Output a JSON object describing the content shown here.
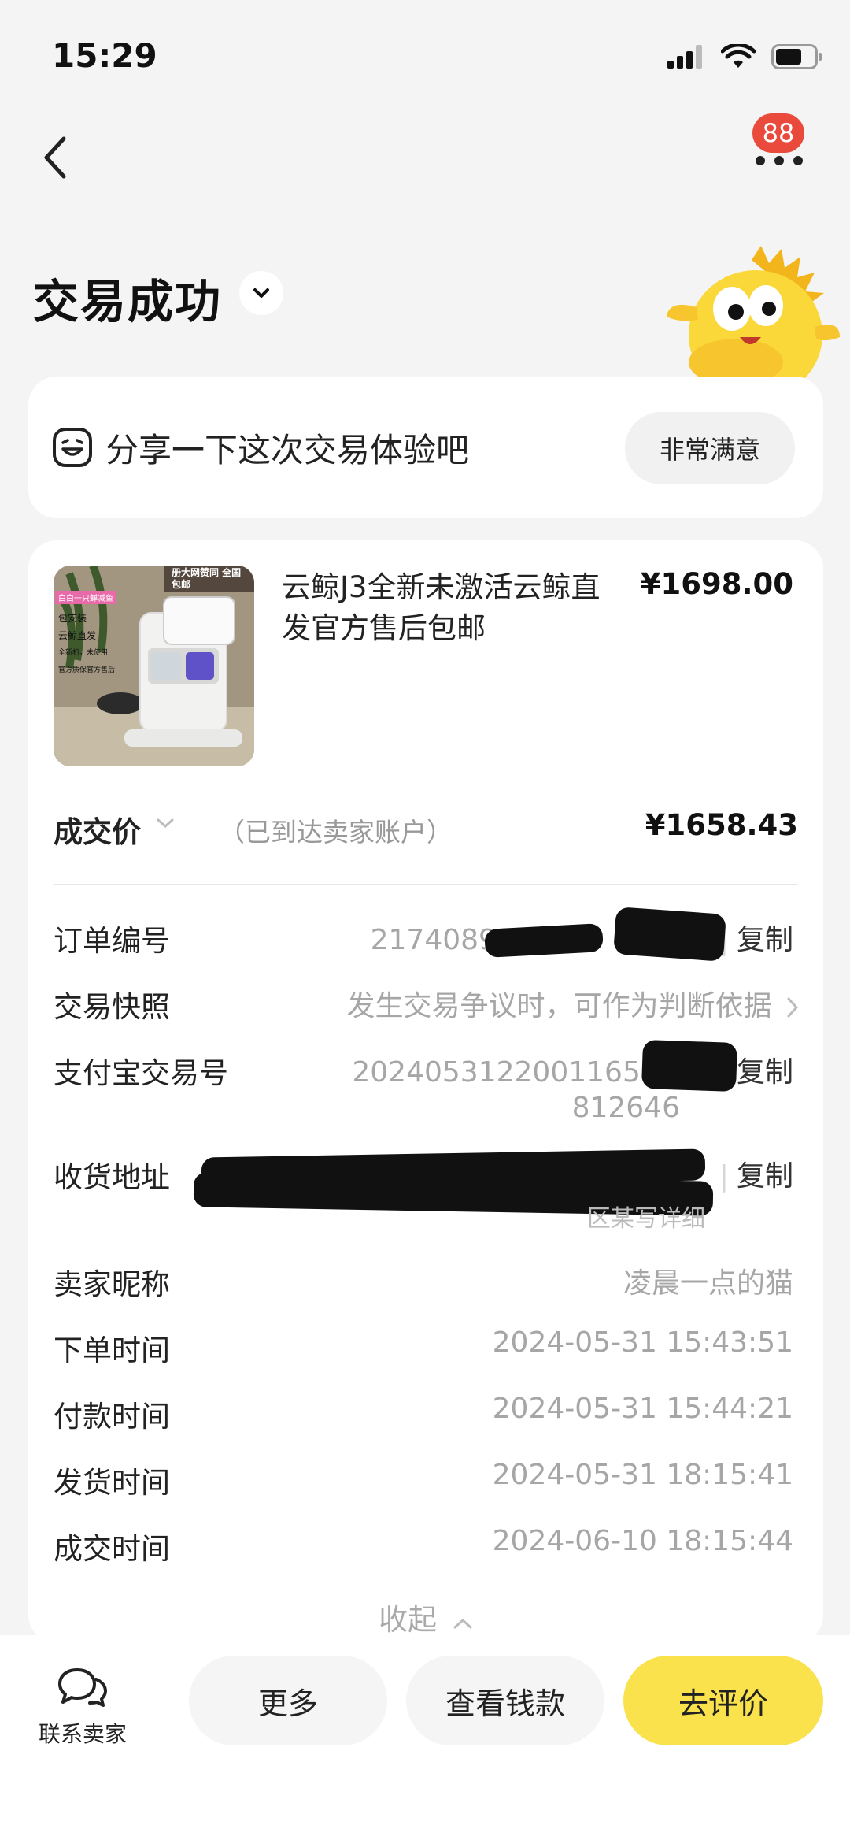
{
  "status": {
    "time": "15:29"
  },
  "nav": {
    "badge_count": "88"
  },
  "header": {
    "title": "交易成功"
  },
  "review_prompt": {
    "text": "分享一下这次交易体验吧",
    "button": "非常满意"
  },
  "product": {
    "title": "云鲸J3全新未激活云鲸直发官方售后包邮",
    "price": "¥1698.00",
    "image_banner": "册大网赞同 全国包邮",
    "image_tag": "白白一只蝉减鱼",
    "image_features": [
      "包安装",
      "云鲸直发",
      "全新机，未使用",
      "官方质保官方售后"
    ]
  },
  "deal": {
    "label": "成交价",
    "note": "（已到达卖家账户）",
    "price": "¥1658.43"
  },
  "info": {
    "order_no": {
      "label": "订单编号",
      "value": "21740897",
      "copy": "复制"
    },
    "snapshot": {
      "label": "交易快照",
      "value": "发生交易争议时，可作为判断依据"
    },
    "alipay_no": {
      "label": "支付宝交易号",
      "value": "2024053122001165",
      "value2": "812646",
      "copy": "复制"
    },
    "address": {
      "label": "收货地址",
      "value": "区某写详细",
      "copy": "复制"
    },
    "seller": {
      "label": "卖家昵称",
      "value": "凌晨一点的猫"
    },
    "order_time": {
      "label": "下单时间",
      "value": "2024-05-31 15:43:51"
    },
    "pay_time": {
      "label": "付款时间",
      "value": "2024-05-31 15:44:21"
    },
    "ship_time": {
      "label": "发货时间",
      "value": "2024-05-31 18:15:41"
    },
    "deal_time": {
      "label": "成交时间",
      "value": "2024-06-10 18:15:44"
    }
  },
  "collapse_label": "收起",
  "bottom": {
    "contact": "联系卖家",
    "more": "更多",
    "view_money": "查看钱款",
    "review": "去评价"
  },
  "colors": {
    "accent": "#fae24c",
    "badge": "#e94a3c",
    "page_bg": "#f4f4f5"
  }
}
